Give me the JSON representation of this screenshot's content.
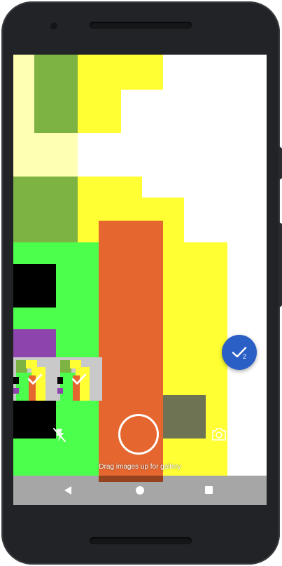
{
  "camera": {
    "selected_count": "2",
    "hint_text": "Drag images up for gallery"
  },
  "icons": {
    "flash": "flash-off-icon",
    "switch_camera": "switch-camera-icon",
    "check": "check-icon",
    "back": "back-triangle-icon",
    "home": "home-circle-icon",
    "recents": "recents-square-icon"
  },
  "colors": {
    "fab": "#2a5fc6",
    "yellow": "#ffff33",
    "pale_yellow": "#ffffb3",
    "olive_green": "#7cb342",
    "bright_green": "#4cff4c",
    "orange": "#e5672f",
    "purple": "#8e44ad",
    "gray_olive": "#6e7354"
  }
}
